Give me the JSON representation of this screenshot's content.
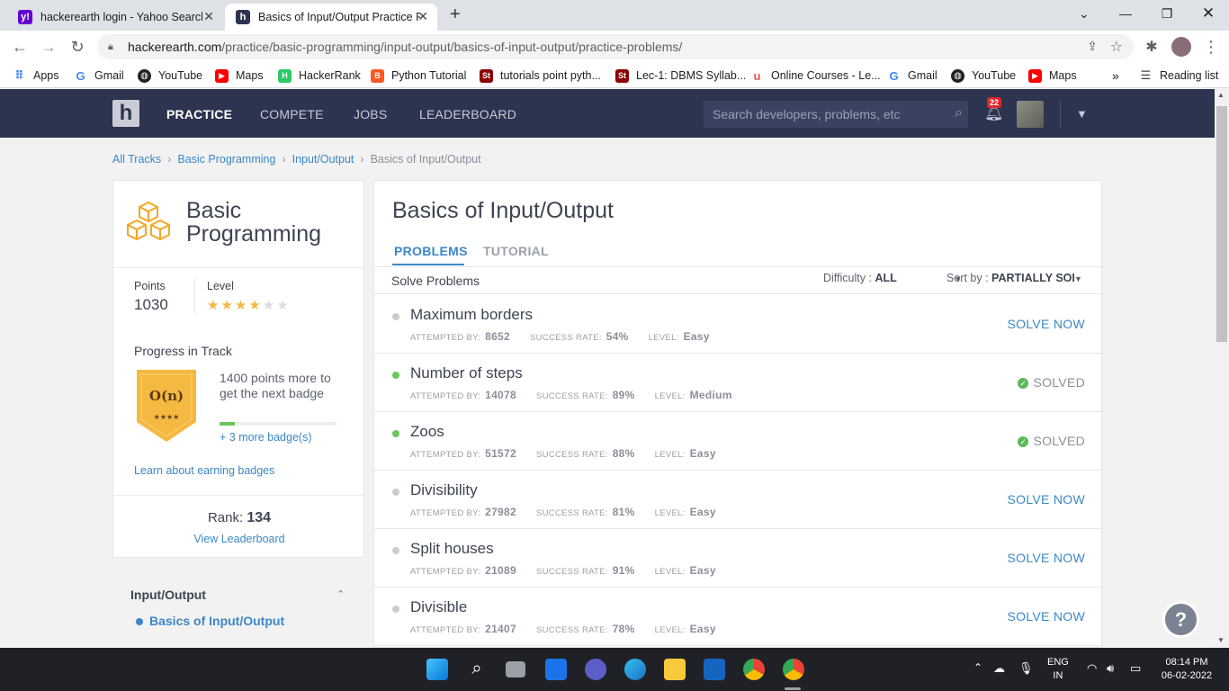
{
  "browser": {
    "tabs": [
      {
        "title": "hackerearth login - Yahoo Search",
        "icon": "yahoo-icon",
        "favicon_text": "y!",
        "color": "#6001d2"
      },
      {
        "title": "Basics of Input/Output Practice P",
        "icon": "hackerearth-icon",
        "favicon_text": "h",
        "color": "#2d3450"
      }
    ],
    "new_tab_label": "+",
    "url_host": "hackerearth.com",
    "url_path": "/practice/basic-programming/input-output/basics-of-input-output/practice-problems/",
    "bookmarks": [
      {
        "label": "Apps",
        "icon": "apps-grid-icon"
      },
      {
        "label": "Gmail",
        "icon": "google-icon"
      },
      {
        "label": "YouTube",
        "icon": "globe-icon"
      },
      {
        "label": "Maps",
        "icon": "youtube-icon"
      },
      {
        "label": "HackerRank",
        "icon": "hackerrank-icon"
      },
      {
        "label": "Python Tutorial",
        "icon": "blogger-icon"
      },
      {
        "label": "tutorials point pyth...",
        "icon": "st-icon"
      },
      {
        "label": "Lec-1: DBMS Syllab...",
        "icon": "st-icon"
      },
      {
        "label": "Online Courses - Le...",
        "icon": "udemy-icon"
      },
      {
        "label": "Gmail",
        "icon": "google-icon"
      },
      {
        "label": "YouTube",
        "icon": "globe-icon"
      },
      {
        "label": "Maps",
        "icon": "youtube-icon"
      }
    ],
    "more_bookmarks": "»",
    "reading_list": "Reading list"
  },
  "nav": {
    "links": [
      "PRACTICE",
      "COMPETE",
      "JOBS",
      "LEADERBOARD"
    ],
    "search_placeholder": "Search developers, problems, etc",
    "notification_count": "22"
  },
  "breadcrumb": [
    "All Tracks",
    "Basic Programming",
    "Input/Output",
    "Basics of Input/Output"
  ],
  "track": {
    "title_line1": "Basic",
    "title_line2": "Programming",
    "points_label": "Points",
    "points": "1030",
    "level_label": "Level",
    "level_stars": 4,
    "level_max": 6,
    "progress_label": "Progress in Track",
    "badge_text": "O(n)",
    "badge_stars": "★★★★",
    "next_badge_text": "1400 points more to get the next badge",
    "next_badge_progress": 0.13,
    "more_badges": "+ 3 more badge(s)",
    "learn_link": "Learn about earning badges",
    "rank_label": "Rank:",
    "rank": "134",
    "leaderboard_link": "View Leaderboard"
  },
  "sidebar": {
    "section": "Input/Output",
    "active_item": "Basics of Input/Output"
  },
  "main": {
    "title": "Basics of Input/Output",
    "tabs": [
      "PROBLEMS",
      "TUTORIAL"
    ],
    "solve_label": "Solve Problems",
    "difficulty_label": "Difficulty :",
    "difficulty_value": "ALL",
    "sort_label": "Sort by :",
    "sort_value": "PARTIALLY SOL",
    "meta_labels": {
      "attempted": "ATTEMPTED BY:",
      "success": "SUCCESS RATE:",
      "level": "LEVEL:"
    },
    "problems": [
      {
        "name": "Maximum borders",
        "attempted": "8652",
        "success": "54%",
        "level": "Easy",
        "solved": false,
        "action": "SOLVE NOW"
      },
      {
        "name": "Number of steps",
        "attempted": "14078",
        "success": "89%",
        "level": "Medium",
        "solved": true,
        "action": "SOLVED"
      },
      {
        "name": "Zoos",
        "attempted": "51572",
        "success": "88%",
        "level": "Easy",
        "solved": true,
        "action": "SOLVED"
      },
      {
        "name": "Divisibility",
        "attempted": "27982",
        "success": "81%",
        "level": "Easy",
        "solved": false,
        "action": "SOLVE NOW"
      },
      {
        "name": "Split houses",
        "attempted": "21089",
        "success": "91%",
        "level": "Easy",
        "solved": false,
        "action": "SOLVE NOW"
      },
      {
        "name": "Divisible",
        "attempted": "21407",
        "success": "78%",
        "level": "Easy",
        "solved": false,
        "action": "SOLVE NOW"
      }
    ]
  },
  "help_label": "?",
  "taskbar": {
    "lang_top": "ENG",
    "lang_bottom": "IN",
    "time": "08:14 PM",
    "date": "06-02-2022"
  },
  "colors": {
    "accent": "#3c87c7",
    "navbar": "#2d3450",
    "solved": "#6bc75b",
    "badge": "#f5b841"
  }
}
